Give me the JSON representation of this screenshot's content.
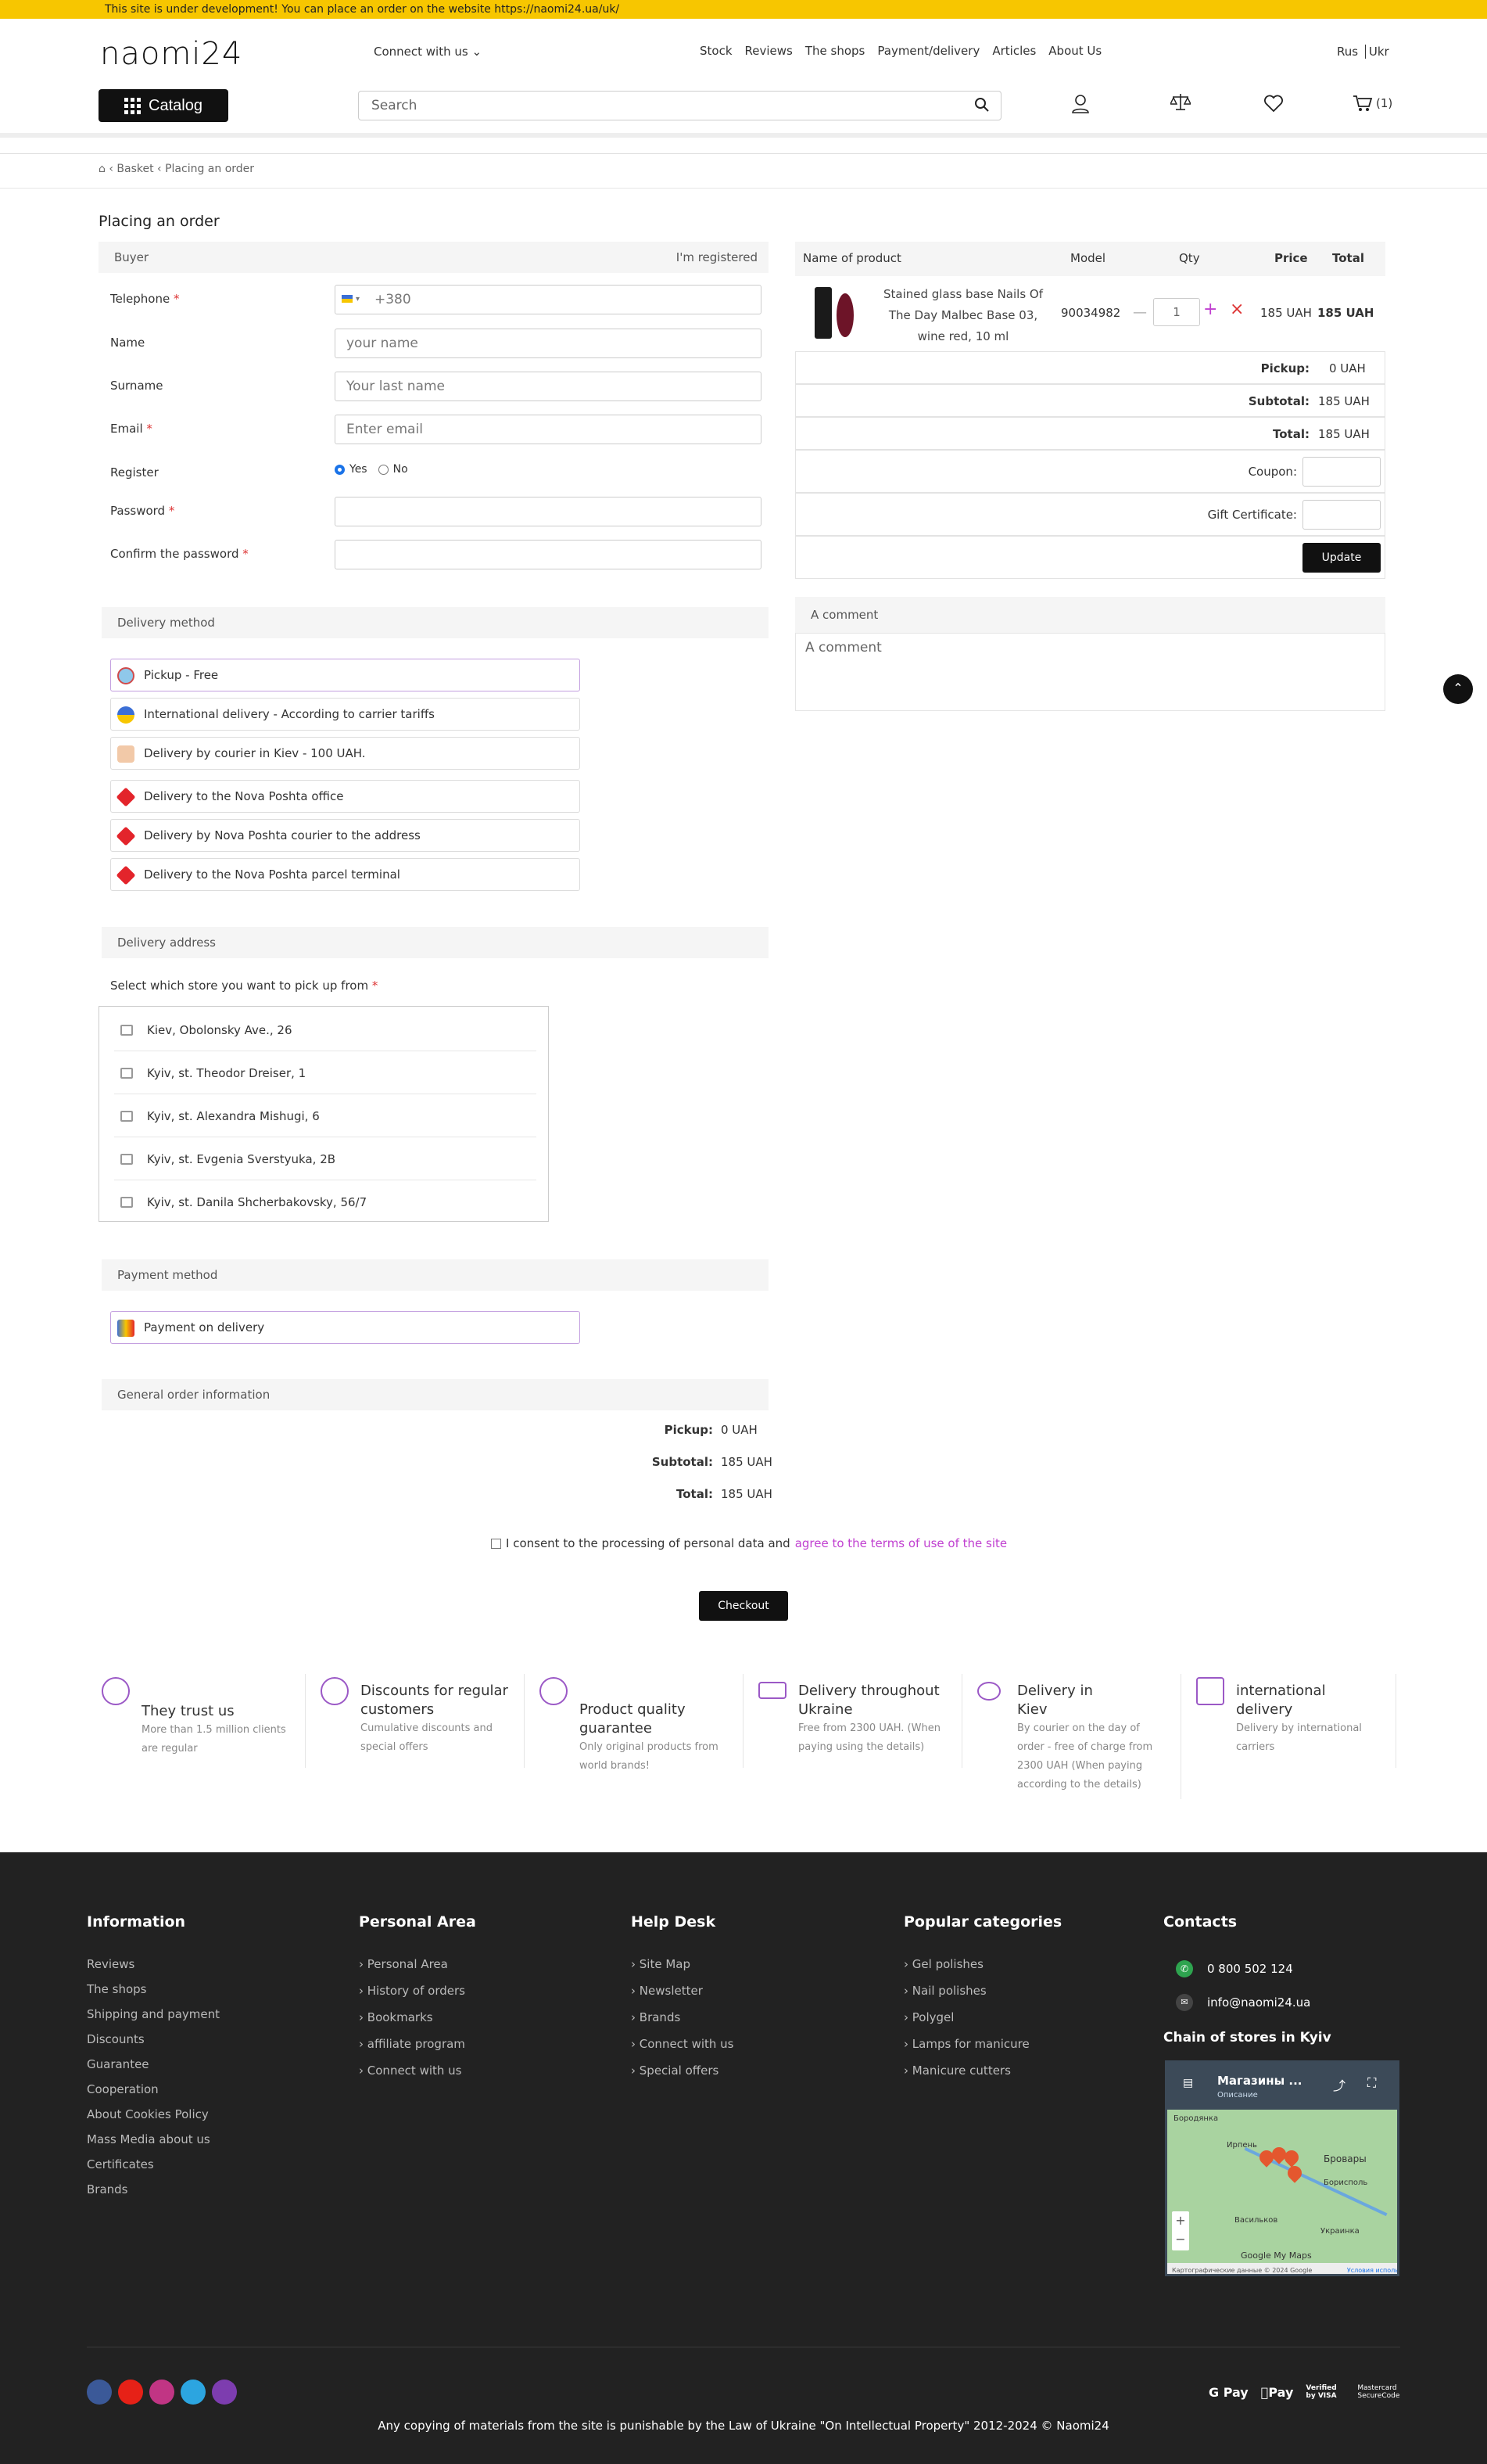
{
  "topbar": {
    "text": "This site is under development! You can place an order on the website https://naomi24.ua/uk/"
  },
  "header": {
    "logo": "naomi24",
    "connect": "Connect with us",
    "menu": [
      "Stock",
      "Reviews",
      "The shops",
      "Payment/delivery",
      "Articles",
      "About Us"
    ],
    "lang_rus": "Rus",
    "lang_ukr": "Ukr",
    "catalog": "Catalog",
    "search_placeholder": "Search",
    "cart_count": "(1)"
  },
  "breadcrumb": [
    "Basket",
    "Placing an order"
  ],
  "page_title": "Placing an order",
  "buyer": {
    "head": "Buyer",
    "registered": "I'm registered",
    "telephone_label": "Telephone",
    "telephone_ph": "+380",
    "name_label": "Name",
    "name_ph": "your name",
    "surname_label": "Surname",
    "surname_ph": "Your last name",
    "email_label": "Email",
    "email_ph": "Enter email",
    "register_label": "Register",
    "yes": "Yes",
    "no": "No",
    "password_label": "Password",
    "confirm_label": "Confirm the password"
  },
  "delivery": {
    "head": "Delivery method",
    "options": [
      "Pickup - Free",
      "International delivery - According to carrier tariffs",
      "Delivery by courier in Kiev - 100 UAH.",
      "Delivery to the Nova Poshta office",
      "Delivery by Nova Poshta courier to the address",
      "Delivery to the Nova Poshta parcel terminal"
    ]
  },
  "address": {
    "head": "Delivery address",
    "select_label": "Select which store you want to pick up from",
    "stores": [
      "Kiev, Obolonsky Ave., 26",
      "Kyiv, st. Theodor Dreiser, 1",
      "Kyiv, st. Alexandra Mishugi, 6",
      "Kyiv, st. Evgenia Sverstyuka, 2B",
      "Kyiv, st. Danila Shcherbakovsky, 56/7"
    ]
  },
  "payment": {
    "head": "Payment method",
    "option": "Payment on delivery"
  },
  "general": {
    "head": "General order information",
    "pickup_l": "Pickup:",
    "pickup_v": "0 UAH",
    "subtotal_l": "Subtotal:",
    "subtotal_v": "185 UAH",
    "total_l": "Total:",
    "total_v": "185 UAH"
  },
  "consent": {
    "text": "I consent to the processing of personal data and",
    "link": "agree to the terms of use of the site"
  },
  "checkout": "Checkout",
  "cart": {
    "h_name": "Name of product",
    "h_model": "Model",
    "h_qty": "Qty",
    "h_price": "Price",
    "h_total": "Total",
    "product": "Stained glass base Nails Of The Day Malbec Base 03, wine red, 10 ml",
    "model": "90034982",
    "qty": "1",
    "price": "185 UAH",
    "total": "185 UAH",
    "pickup_l": "Pickup:",
    "pickup_v": "0 UAH",
    "subtotal_l": "Subtotal:",
    "subtotal_v": "185 UAH",
    "total_l": "Total:",
    "total_v": "185 UAH",
    "coupon": "Coupon:",
    "gift": "Gift Certificate:",
    "update": "Update"
  },
  "comment": {
    "head": "A comment",
    "ph": "A comment"
  },
  "features": [
    {
      "title": "They trust us",
      "sub": "More than 1.5 million clients are regular"
    },
    {
      "title": "Discounts for regular customers",
      "sub": "Cumulative discounts and special offers"
    },
    {
      "title": "Product quality guarantee",
      "sub": "Only original products from world brands!"
    },
    {
      "title": "Delivery throughout Ukraine",
      "sub": "Free from 2300 UAH. (When paying using the details)"
    },
    {
      "title": "Delivery in Kiev",
      "sub": "By courier on the day of order - free of charge from 2300 UAH (When paying according to the details)"
    },
    {
      "title": "international delivery",
      "sub": "Delivery by international carriers"
    }
  ],
  "footer": {
    "info_h": "Information",
    "info": [
      "Reviews",
      "The shops",
      "Shipping and payment",
      "Discounts",
      "Guarantee",
      "Cooperation",
      "About Cookies Policy",
      "Mass Media about us",
      "Certificates",
      "Brands"
    ],
    "personal_h": "Personal Area",
    "personal": [
      "Personal Area",
      "History of orders",
      "Bookmarks",
      "affiliate program",
      "Connect with us"
    ],
    "help_h": "Help Desk",
    "help": [
      "Site Map",
      "Newsletter",
      "Brands",
      "Connect with us",
      "Special offers"
    ],
    "popular_h": "Popular categories",
    "popular": [
      "Gel polishes",
      "Nail polishes",
      "Polygel",
      "Lamps for manicure",
      "Manicure cutters"
    ],
    "contacts_h": "Contacts",
    "phone": "0 800 502 124",
    "email": "info@naomi24.ua",
    "chain_h": "Chain of stores in Kyiv",
    "map_title": "Магазины ...",
    "map_desc": "Описание",
    "map_labels": [
      "Бородянка",
      "Ирпень",
      "Бровары",
      "Борисполь",
      "Васильков",
      "Украинка"
    ],
    "map_footer": "Картографические данные © 2024 Google",
    "map_terms": "Условия исполь",
    "map_google": "Google My Maps",
    "pay": [
      "G Pay",
      "Pay",
      "Verified by VISA",
      "Mastercard SecureCode"
    ],
    "copyright": "Any copying of materials from the site is punishable by the Law of Ukraine \"On Intellectual Property\" 2012-2024 © Naomi24"
  },
  "colors": {
    "accent": "#f7c600",
    "link": "#c03fd0",
    "dark": "#111111",
    "footer": "#222222"
  }
}
